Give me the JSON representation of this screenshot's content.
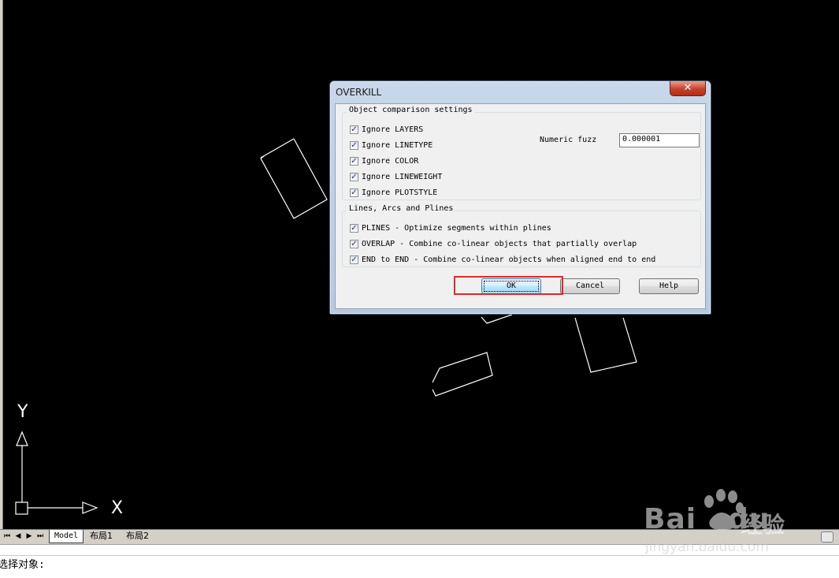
{
  "dialog": {
    "title": "OVERKILL",
    "close_glyph": "✕",
    "group_object": {
      "legend": "Object comparison settings",
      "items": [
        {
          "label": "Ignore LAYERS",
          "checked": true
        },
        {
          "label": "Ignore LINETYPE",
          "checked": true
        },
        {
          "label": "Ignore COLOR",
          "checked": true
        },
        {
          "label": "Ignore LINEWEIGHT",
          "checked": true
        },
        {
          "label": "Ignore PLOTSTYLE",
          "checked": true
        }
      ],
      "numeric_fuzz_label": "Numeric fuzz",
      "numeric_fuzz_value": "0.000001"
    },
    "group_lines": {
      "legend": "Lines, Arcs and Plines",
      "items": [
        {
          "label": "PLINES - Optimize segments within plines",
          "checked": true
        },
        {
          "label": "OVERLAP - Combine co-linear objects that partially overlap",
          "checked": true
        },
        {
          "label": "END to END - Combine co-linear objects when aligned end to end",
          "checked": true
        }
      ]
    },
    "buttons": {
      "ok": "OK",
      "cancel": "Cancel",
      "help": "Help"
    },
    "check_glyph": "✓",
    "highlight_color": "#e0282a"
  },
  "ucs": {
    "x_label": "X",
    "y_label": "Y"
  },
  "tabs": {
    "nav": [
      "⏮",
      "◀",
      "▶",
      "⏭"
    ],
    "model": "Model",
    "layout1": "布局1",
    "layout2": "布局2"
  },
  "command_line": {
    "prompt": "选择对象:"
  },
  "watermark": {
    "brand": "Bai",
    "brand2": "du",
    "cn": "经验",
    "url": "jingyan.baidu.com"
  }
}
